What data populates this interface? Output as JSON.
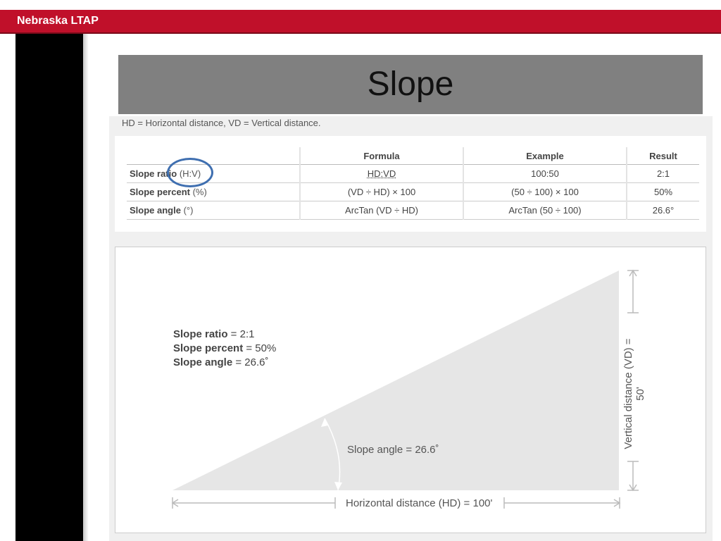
{
  "header": {
    "brand": "Nebraska LTAP"
  },
  "slide": {
    "title": "Slope"
  },
  "caption": "HD = Horizontal distance, VD = Vertical distance.",
  "table": {
    "headers": [
      "Formula",
      "Example",
      "Result"
    ],
    "rows": [
      {
        "label": "Slope ratio",
        "unit": "(H:V)",
        "formula": "HD:VD",
        "example": "100:50",
        "result": "2:1"
      },
      {
        "label": "Slope percent",
        "unit": "(%)",
        "formula": "(VD ÷ HD) × 100",
        "example": "(50 ÷ 100) × 100",
        "result": "50%"
      },
      {
        "label": "Slope angle",
        "unit": "(°)",
        "formula": "ArcTan (VD ÷ HD)",
        "example": "ArcTan (50 ÷ 100)",
        "result": "26.6°"
      }
    ]
  },
  "diagram": {
    "summary": [
      {
        "label": "Slope ratio",
        "value": " = 2:1"
      },
      {
        "label": "Slope percent",
        "value": " = 50%"
      },
      {
        "label": "Slope angle",
        "value": " = 26.6˚"
      }
    ],
    "angle_label": "Slope angle = 26.6˚",
    "hd_label": "Horizontal distance (HD) = 100'",
    "vd_label": "Vertical distance (VD) = 50'"
  },
  "colors": {
    "brand_red": "#c0102a",
    "highlight_circle": "#3f6fb0",
    "header_gray": "#808080",
    "triangle_fill": "#e6e6e6"
  }
}
